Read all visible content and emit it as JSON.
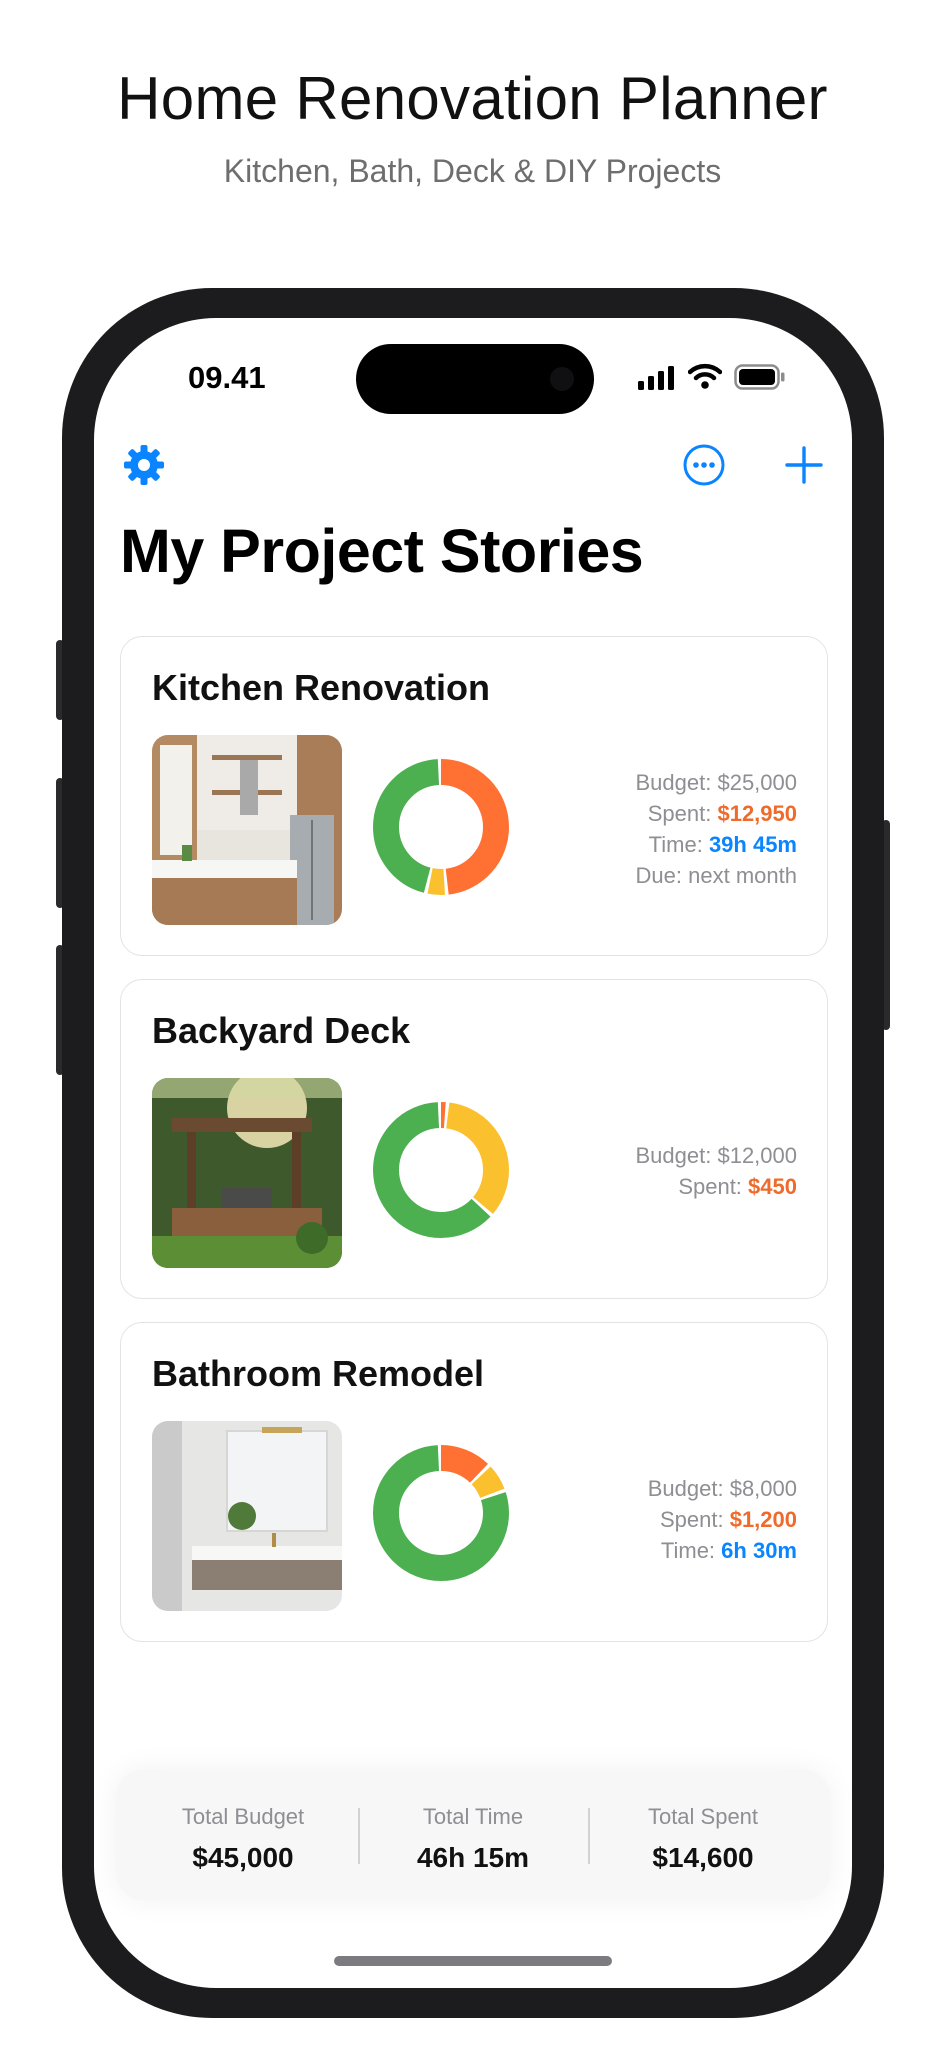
{
  "promo": {
    "title": "Home Renovation Planner",
    "subtitle": "Kitchen, Bath, Deck & DIY Projects"
  },
  "status_bar": {
    "time": "09.41",
    "icons": [
      "cellular-signal-icon",
      "wifi-icon",
      "battery-icon"
    ]
  },
  "nav": {
    "left_icon": "gear-icon",
    "right_icons": [
      "ellipsis-circle-icon",
      "plus-icon"
    ],
    "accent_color": "#0a84ff"
  },
  "page_title": "My Project Stories",
  "colors": {
    "green": "#4caf50",
    "orange": "#ff7033",
    "yellow": "#fbc02d",
    "spent": "#ef6b2b",
    "time": "#0a84ff"
  },
  "projects": [
    {
      "title": "Kitchen Renovation",
      "image": "kitchen-photo",
      "donut": [
        {
          "label": "orange",
          "fraction": 0.49
        },
        {
          "label": "yellow",
          "fraction": 0.05
        },
        {
          "label": "green",
          "fraction": 0.46
        }
      ],
      "budget_label": "Budget:",
      "budget": "$25,000",
      "spent_label": "Spent:",
      "spent": "$12,950",
      "time_label": "Time:",
      "time": "39h 45m",
      "due_label": "Due:",
      "due": "next month"
    },
    {
      "title": "Backyard Deck",
      "image": "deck-photo",
      "donut": [
        {
          "label": "orange",
          "fraction": 0.02
        },
        {
          "label": "yellow",
          "fraction": 0.35
        },
        {
          "label": "green",
          "fraction": 0.63
        }
      ],
      "budget_label": "Budget:",
      "budget": "$12,000",
      "spent_label": "Spent:",
      "spent": "$450"
    },
    {
      "title": "Bathroom Remodel",
      "image": "bathroom-photo",
      "donut": [
        {
          "label": "orange",
          "fraction": 0.13
        },
        {
          "label": "yellow",
          "fraction": 0.07
        },
        {
          "label": "green",
          "fraction": 0.8
        }
      ],
      "budget_label": "Budget:",
      "budget": "$8,000",
      "spent_label": "Spent:",
      "spent": "$1,200",
      "time_label": "Time:",
      "time": "6h 30m"
    }
  ],
  "totals": {
    "budget_label": "Total Budget",
    "budget": "$45,000",
    "time_label": "Total Time",
    "time": "46h 15m",
    "spent_label": "Total Spent",
    "spent": "$14,600"
  }
}
